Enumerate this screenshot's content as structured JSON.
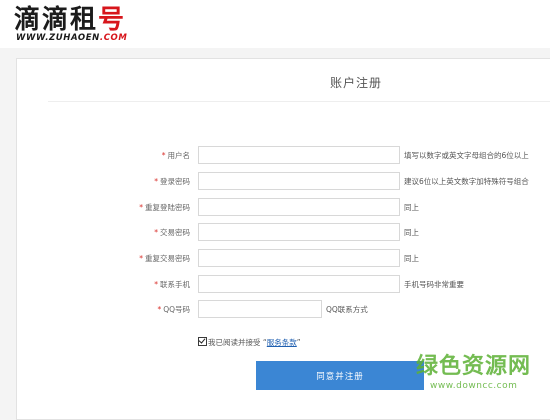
{
  "header": {
    "logo_cn_main": "滴滴租",
    "logo_cn_accent": "号",
    "logo_en_main": "WWW.ZUHAOEN",
    "logo_en_accent": ".COM"
  },
  "form": {
    "title": "账户注册",
    "required_mark": "*",
    "fields": [
      {
        "label": "用户名",
        "value": "",
        "hint": "填写以数字或英文字母组合的6位以上"
      },
      {
        "label": "登录密码",
        "value": "",
        "hint": "建议6位以上英文数字加特殊符号组合"
      },
      {
        "label": "重复登陆密码",
        "value": "",
        "hint": "同上"
      },
      {
        "label": "交易密码",
        "value": "",
        "hint": "同上"
      },
      {
        "label": "重复交易密码",
        "value": "",
        "hint": "同上"
      },
      {
        "label": "联系手机",
        "value": "",
        "hint": "手机号码非常重要"
      },
      {
        "label": "QQ号码",
        "value": "",
        "hint": "QQ联系方式"
      }
    ],
    "agree_text": "我已阅读并接受 “",
    "agree_link": "服务条款",
    "agree_tail": "”",
    "agree_checked": true,
    "submit_label": "同意并注册"
  },
  "watermark": {
    "cn": "绿色资源网",
    "en": "www.downcc.com"
  },
  "colors": {
    "brand_red": "#d7151b",
    "button_blue": "#3b86d4",
    "link_blue": "#1f5fb0",
    "required_red": "#d9302b",
    "watermark_green": "#5cb135"
  }
}
